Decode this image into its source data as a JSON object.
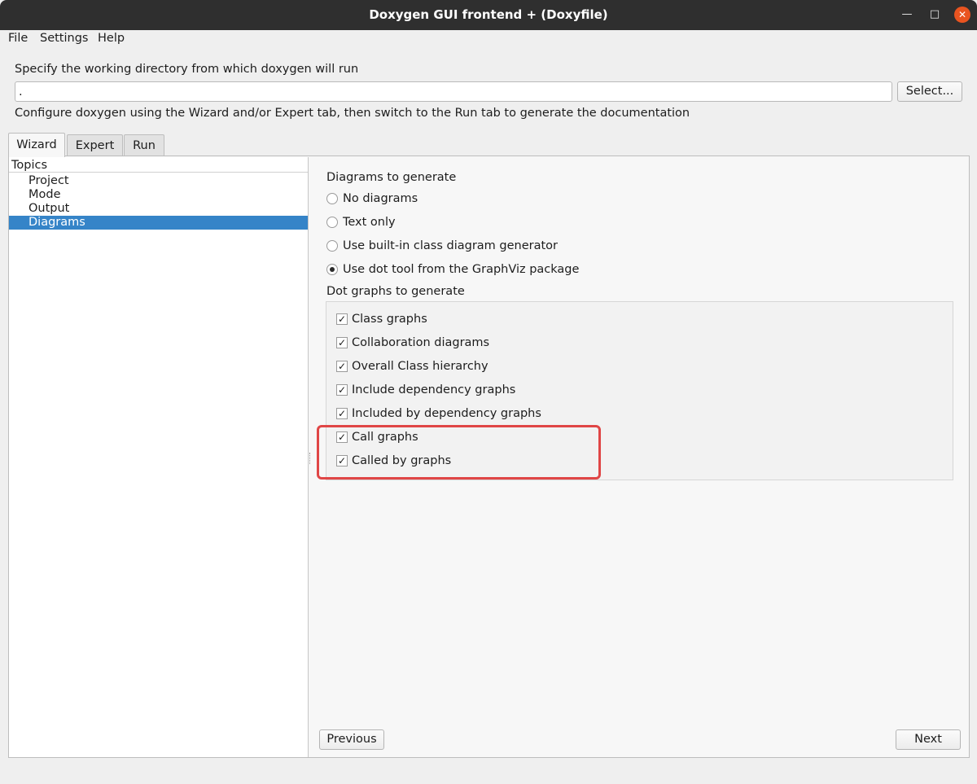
{
  "window": {
    "title": "Doxygen GUI frontend + (Doxyfile)"
  },
  "menu": {
    "items": [
      "File",
      "Settings",
      "Help"
    ]
  },
  "workdir": {
    "label": "Specify the working directory from which doxygen will run",
    "value": ".",
    "select_button": "Select...",
    "hint": "Configure doxygen using the Wizard and/or Expert tab, then switch to the Run tab to generate the documentation"
  },
  "tabs": [
    "Wizard",
    "Expert",
    "Run"
  ],
  "active_tab": "Wizard",
  "topics": {
    "header": "Topics",
    "items": [
      "Project",
      "Mode",
      "Output",
      "Diagrams"
    ],
    "selected": "Diagrams"
  },
  "diagrams": {
    "heading": "Diagrams to generate",
    "options": [
      {
        "label": "No diagrams",
        "checked": false
      },
      {
        "label": "Text only",
        "checked": false
      },
      {
        "label": "Use built-in class diagram generator",
        "checked": false
      },
      {
        "label": "Use dot tool from the GraphViz package",
        "checked": true
      }
    ]
  },
  "dot_graphs": {
    "heading": "Dot graphs to generate",
    "options": [
      {
        "label": "Class graphs",
        "checked": true
      },
      {
        "label": "Collaboration diagrams",
        "checked": true
      },
      {
        "label": "Overall Class hierarchy",
        "checked": true
      },
      {
        "label": "Include dependency graphs",
        "checked": true
      },
      {
        "label": "Included by dependency graphs",
        "checked": true
      },
      {
        "label": "Call graphs",
        "checked": true
      },
      {
        "label": "Called by graphs",
        "checked": true
      }
    ]
  },
  "nav": {
    "previous": "Previous",
    "next": "Next"
  },
  "icons": {
    "minimize": "minimize-icon",
    "maximize": "maximize-icon",
    "close": "close-icon",
    "check": "check-icon"
  },
  "colors": {
    "titlebar": "#2f2f2f",
    "close_button": "#e95420",
    "selection": "#3584c8",
    "highlight_box": "#e04646"
  }
}
